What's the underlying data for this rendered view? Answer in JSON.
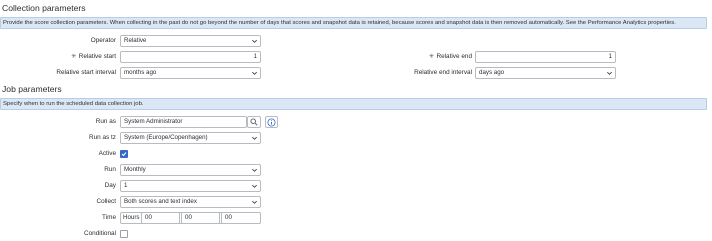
{
  "collection": {
    "title": "Collection parameters",
    "info": "Provide the score collection parameters. When collecting in the past do not go beyond the number of days that scores and snapshot data is retained, because scores and snapshot data is then removed automatically. See the Performance Analytics properties.",
    "operator_label": "Operator",
    "operator_value": "Relative",
    "relative_start_label": "Relative start",
    "relative_start_value": "1",
    "relative_start_interval_label": "Relative start interval",
    "relative_start_interval_value": "months ago",
    "relative_end_label": "Relative end",
    "relative_end_value": "1",
    "relative_end_interval_label": "Relative end interval",
    "relative_end_interval_value": "days ago",
    "required_marker": "✳"
  },
  "job": {
    "title": "Job parameters",
    "info": "Specify when to run the scheduled data collection job.",
    "run_as_label": "Run as",
    "run_as_value": "System Administrator",
    "run_as_tz_label": "Run as tz",
    "run_as_tz_value": "System (Europe/Copenhagen)",
    "active_label": "Active",
    "active_checked": true,
    "run_label": "Run",
    "run_value": "Monthly",
    "day_label": "Day",
    "day_value": "1",
    "collect_label": "Collect",
    "collect_value": "Both scores and text index",
    "time_label": "Time",
    "time_hours_label": "Hours",
    "time_hours": "00",
    "time_minutes": "00",
    "time_seconds": "00",
    "conditional_label": "Conditional",
    "conditional_checked": false
  },
  "colors": {
    "accent": "#3a68c8",
    "info_bg": "#dce7f5",
    "border": "#b7bcc3"
  },
  "icons": [
    "search-icon",
    "info-icon",
    "chevron-down-icon",
    "checkmark-icon"
  ]
}
